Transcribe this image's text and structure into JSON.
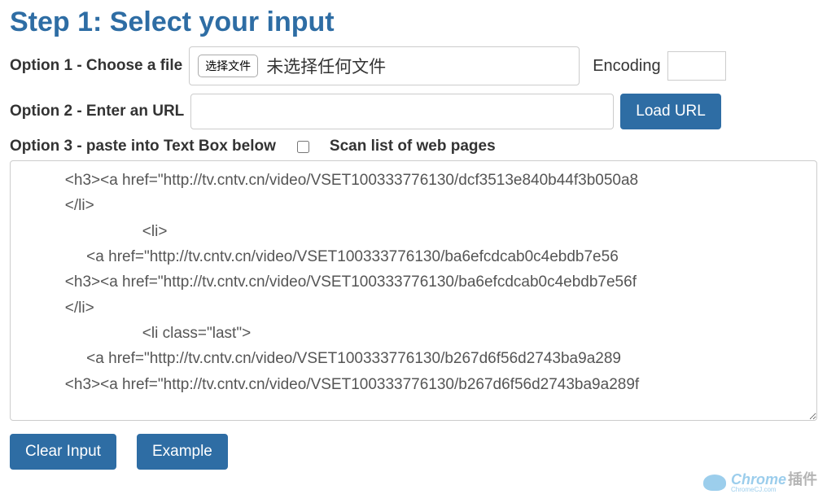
{
  "heading": "Step 1: Select your input",
  "option1": {
    "label": "Option 1 - Choose a file",
    "fileButton": "选择文件",
    "fileStatus": "未选择任何文件",
    "encodingLabel": "Encoding",
    "encodingValue": ""
  },
  "option2": {
    "label": "Option 2 - Enter an URL",
    "urlValue": "",
    "loadUrlLabel": "Load URL"
  },
  "option3": {
    "label": "Option 3 - paste into Text Box below",
    "checkboxLabel": "Scan list of web pages",
    "textareaValue": "          <h3><a href=\"http://tv.cntv.cn/video/VSET100333776130/dcf3513e840b44f3b050a8\n          </li>\n                            <li>\n               <a href=\"http://tv.cntv.cn/video/VSET100333776130/ba6efcdcab0c4ebdb7e56\n          <h3><a href=\"http://tv.cntv.cn/video/VSET100333776130/ba6efcdcab0c4ebdb7e56f\n          </li>\n                            <li class=\"last\">\n               <a href=\"http://tv.cntv.cn/video/VSET100333776130/b267d6f56d2743ba9a289\n          <h3><a href=\"http://tv.cntv.cn/video/VSET100333776130/b267d6f56d2743ba9a289f"
  },
  "buttons": {
    "clearInput": "Clear Input",
    "example": "Example"
  },
  "watermark": {
    "main": "Chrome",
    "cn": "插件",
    "sub": "ChromeCJ.com"
  }
}
